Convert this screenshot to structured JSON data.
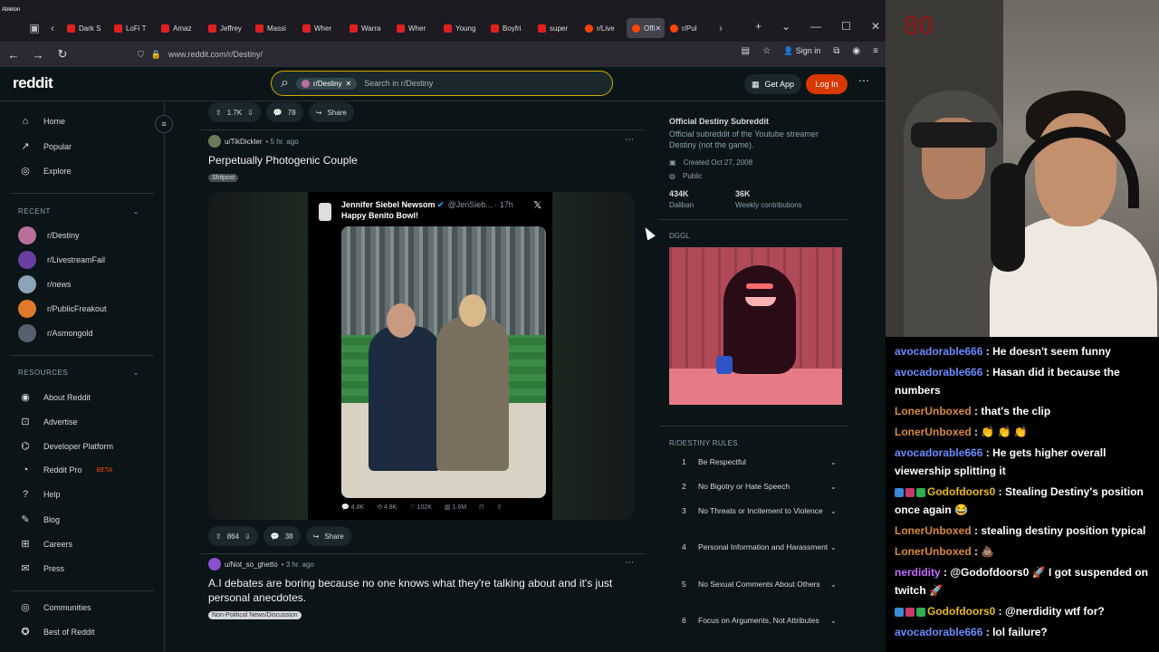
{
  "browser": {
    "recording_label": "Ableton",
    "tabs": [
      {
        "label": "Dark S",
        "kind": "youtube"
      },
      {
        "label": "LoFi T",
        "kind": "youtube"
      },
      {
        "label": "Amaz",
        "kind": "youtube"
      },
      {
        "label": "Jeffrey",
        "kind": "youtube"
      },
      {
        "label": "Massi",
        "kind": "youtube"
      },
      {
        "label": "Wher",
        "kind": "youtube"
      },
      {
        "label": "Warra",
        "kind": "youtube"
      },
      {
        "label": "Wher",
        "kind": "youtube"
      },
      {
        "label": "Young",
        "kind": "youtube"
      },
      {
        "label": "Boyfri",
        "kind": "youtube"
      },
      {
        "label": "super",
        "kind": "youtube"
      },
      {
        "label": "r/Live",
        "kind": "reddit"
      },
      {
        "label": "Offi",
        "kind": "reddit",
        "active": true
      },
      {
        "label": "r/Pul",
        "kind": "reddit"
      }
    ],
    "url": "www.reddit.com/r/Destiny/",
    "sign_in": "Sign in"
  },
  "header": {
    "logo": "reddit",
    "search_chip": "r/Destiny",
    "search_placeholder": "Search in r/Destiny",
    "get_app": "Get App",
    "login": "Log In"
  },
  "sidebar": {
    "main": [
      {
        "label": "Home",
        "icon": "home-icon"
      },
      {
        "label": "Popular",
        "icon": "popular-icon"
      },
      {
        "label": "Explore",
        "icon": "explore-icon"
      }
    ],
    "recent_label": "RECENT",
    "recent": [
      {
        "label": "r/Destiny",
        "color": "#b96f9c"
      },
      {
        "label": "r/LivestreamFail",
        "color": "#6b3fa0"
      },
      {
        "label": "r/news",
        "color": "#8aa4b8"
      },
      {
        "label": "r/PublicFreakout",
        "color": "#e07a2a"
      },
      {
        "label": "r/Asmongold",
        "color": "#556070"
      }
    ],
    "resources_label": "RESOURCES",
    "resources": [
      {
        "label": "About Reddit"
      },
      {
        "label": "Advertise"
      },
      {
        "label": "Developer Platform"
      },
      {
        "label": "Reddit Pro",
        "badge": "BETA"
      },
      {
        "label": "Help"
      },
      {
        "label": "Blog"
      },
      {
        "label": "Careers"
      },
      {
        "label": "Press"
      }
    ],
    "bottom": [
      {
        "label": "Communities"
      },
      {
        "label": "Best of Reddit"
      }
    ]
  },
  "feed": {
    "top_actions": {
      "votes": "1.7K",
      "comments": "78",
      "share": "Share"
    },
    "post1": {
      "author": "u/TikDickler",
      "time": "5 hr. ago",
      "title": "Perpetually Photogenic Couple",
      "flair": "Shitpost",
      "tweet": {
        "name": "Jennifer Siebel Newsom",
        "handle": "@JenSieb... · 17h",
        "text": "Happy Benito Bowl!",
        "stats": [
          "4.8K",
          "4.8K",
          "102K",
          "1.6M"
        ]
      },
      "votes": "864",
      "comments": "38",
      "share": "Share"
    },
    "post2": {
      "author": "u/Not_so_ghetto",
      "time": "3 hr. ago",
      "title": "A.I debates are boring because no one knows what they're talking about and it's just personal anecdotes.",
      "flair": "Non-Political News/Discussion"
    }
  },
  "sidecard": {
    "title": "Official Destiny Subreddit",
    "description": "Official subreddit of the Youtube streamer Destiny (not the game).",
    "created": "Created Oct 27, 2008",
    "visibility": "Public",
    "members": "434K",
    "members_label": "Daliban",
    "contrib": "36K",
    "contrib_label": "Weekly contributions",
    "image_label": "DGGL",
    "rules_label": "R/DESTINY RULES",
    "rules": [
      {
        "n": "1",
        "text": "Be Respectful"
      },
      {
        "n": "2",
        "text": "No Bigotry or Hate Speech"
      },
      {
        "n": "3",
        "text": "No Threats or Incitement to Violence"
      },
      {
        "n": "4",
        "text": "Personal Information and Harassment"
      },
      {
        "n": "5",
        "text": "No Sexual Comments About Others"
      },
      {
        "n": "6",
        "text": "Focus on Arguments, Not Attributes"
      }
    ]
  },
  "chat": [
    {
      "user": "avocadorable666",
      "color": "#6a8cff",
      "text": "He doesn't seem funny"
    },
    {
      "user": "avocadorable666",
      "color": "#6a8cff",
      "text": "Hasan did it because the numbers"
    },
    {
      "user": "LonerUnboxed",
      "color": "#d88a3a",
      "text": "that's the clip"
    },
    {
      "user": "LonerUnboxed",
      "color": "#d88a3a",
      "text": "👏 👏 👏"
    },
    {
      "user": "avocadorable666",
      "color": "#6a8cff",
      "text": "He gets higher overall viewership splitting it"
    },
    {
      "user": "Godofdoors0",
      "color": "#e8b923",
      "text": "Stealing Destiny's position once again 😂",
      "badges": true
    },
    {
      "user": "LonerUnboxed",
      "color": "#d88a3a",
      "text": "stealing destiny position typical"
    },
    {
      "user": "LonerUnboxed",
      "color": "#d88a3a",
      "text": "💩"
    },
    {
      "user": "nerdidity",
      "color": "#c46bff",
      "text": "@Godofdoors0 🚀 I got suspended on twitch 🚀"
    },
    {
      "user": "Godofdoors0",
      "color": "#e8b923",
      "text": "@nerdidity wtf for?",
      "badges": true
    },
    {
      "user": "avocadorable666",
      "color": "#6a8cff",
      "text": "lol failure?"
    }
  ]
}
